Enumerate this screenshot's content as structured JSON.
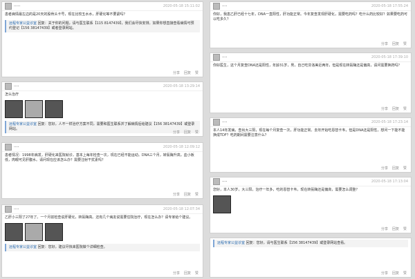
{
  "left": [
    {
      "user": "·····",
      "time": "2020-05-18 15:11:02",
      "text": "患者病情最左边的是20天的股骨头卡号，现在比较五水水，肝硬化等不要紧吗？",
      "reply_author": "远程专家公益诊室",
      "reply": "回复：关于你的问题，请与医生联系【115 8147439】，我们会尽快安排。如果你想直接查看病情可预约登记【156 38147439】或者登录网站。",
      "images": 0
    },
    {
      "user": "····",
      "time": "2020-05-18 13:29:14",
      "text": "怎么治疗",
      "reply_author": "远程专家公益诊室",
      "reply": "回复：您好，人不一样治疗方案不同，需要和医生联系并了解病情后给建议【156 38147439】或登录网站。",
      "images": 3
    },
    {
      "user": "····",
      "time": "2020-05-18 12:09:12",
      "text": "患者情况：1998年病发，肝硬化来医院就诊，基本上每年检查一次，现在已经不能运动。DNA三个月，转氨酶升高，血小板低，肉眼可见肝腹水。请问现在应该怎么办？需要注射干扰素吗？",
      "reply_author": "",
      "reply": "",
      "images": 0
    },
    {
      "user": "····",
      "time": "2020-05-18 12:07:34",
      "text": "乙肝小三阳了27年了。一个月前检查说肝硬化，转氨酶高。还有几个病友说需要住院治疗，现在怎么办？请专家给个建议。",
      "reply_author": "远程专家公益诊室",
      "reply": "回复：您好，建议尽快来医院做个详细检查。",
      "images": 3
    }
  ],
  "right": [
    {
      "user": "····",
      "time": "2020-05-18 17:55:24",
      "text": "你好，我患乙肝已经十七年，DNA一直阳性，肝功能正常。今年复查发现肝硬化，需要吃药吗？吃什么药比较好？如果要吃药可以吃多久？",
      "reply_author": "",
      "reply": "",
      "images": 0
    },
    {
      "user": "····",
      "time": "2020-05-18 17:39:10",
      "text": "你好医生，这个月复查DNA还是阳性，年龄31岁，男，自己吃芬洛美近两年，但是现在转氨酶还是偏高，请问需要换药吗？",
      "reply_author": "",
      "reply": "",
      "images": 0
    },
    {
      "user": "····",
      "time": "2020-05-18 17:23:14",
      "text": "本人14年发病，查出大三阳，现在每个月复查一次，肝功能正常。去年开始吃恩替卡韦，但是DNA还是阳性，想问一下能不能换成TDF？吃药期间需要注意什么？",
      "reply_author": "",
      "reply": "",
      "images": 0
    },
    {
      "user": "····",
      "time": "2020-05-18 17:13:04",
      "text": "您好，本人30岁，大三阳，治疗一年多，吃的恩替卡韦，现在转氨酶还是偏高，需要怎么调整？",
      "reply_author": "",
      "reply": "",
      "images": 1
    },
    {
      "user": "",
      "time": "",
      "text": "",
      "reply_author": "远程专家公益诊室",
      "reply": "回复：您好，请与医生联系【156 38147439】或登录网站查看。",
      "images": 0
    }
  ],
  "footer": {
    "share": "分享",
    "reply": "回复",
    "like": "赞"
  }
}
